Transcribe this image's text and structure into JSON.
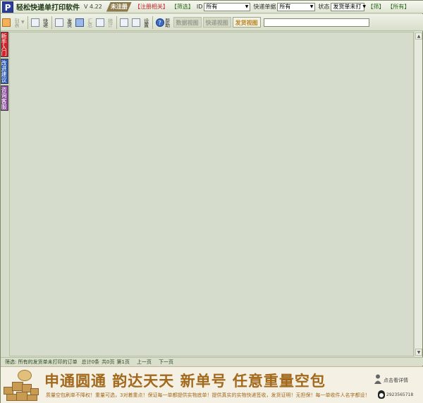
{
  "window": {
    "logo_letter": "P",
    "title": "轻松快递单打印软件",
    "version": "V 4.22",
    "reg_status": "未注册",
    "link_register": "【注册相关】",
    "link_filter": "【筛选】"
  },
  "filters": {
    "id_label": "ID",
    "id_value": "所有",
    "waybill_label": "快递单据",
    "waybill_value": "所有",
    "status_label": "状态",
    "status_value": "发货单未打",
    "link_small": "【筛】",
    "link_all": "【所有】"
  },
  "toolbar": {
    "buttons": [
      {
        "label": "新建"
      },
      {
        "label": "列表"
      },
      {
        "label": "打印"
      },
      {
        "label": "快递"
      },
      {
        "label": "打印"
      },
      {
        "label": "发货"
      },
      {
        "label": "清单"
      },
      {
        "label": "汇总"
      },
      {
        "label": "查询"
      },
      {
        "label": "统计"
      },
      {
        "label": "导出"
      },
      {
        "label": "工具"
      },
      {
        "label": "设置"
      },
      {
        "label": "帮助"
      }
    ],
    "tabs": [
      "数据视图",
      "快递视图",
      "发货视图"
    ],
    "active_tab": 2
  },
  "side_tabs": [
    "新手入门",
    "改进建议",
    "咨询客服"
  ],
  "status": {
    "filter_text": "筛选: 所有的发货单未打印的订单",
    "total": "总计0条",
    "pages": "共0页",
    "current_page": "第1页",
    "prev": "上一页",
    "next": "下一页"
  },
  "banner": {
    "headline": "申通圆通 韵达天天 新单号 任意重量空包",
    "sub": "质量空包刷单不降权！重量可选，3对着重点！保证每一单都提供实物底单！提供真实的实物快递签收，发货证明！无担保！每一单收件人名字都设！",
    "link": "点击看详情",
    "qq": "2923565718"
  },
  "colors": {
    "accent_red": "#d4242a",
    "accent_blue": "#2b5ab5",
    "banner_gold": "#a2691c"
  }
}
